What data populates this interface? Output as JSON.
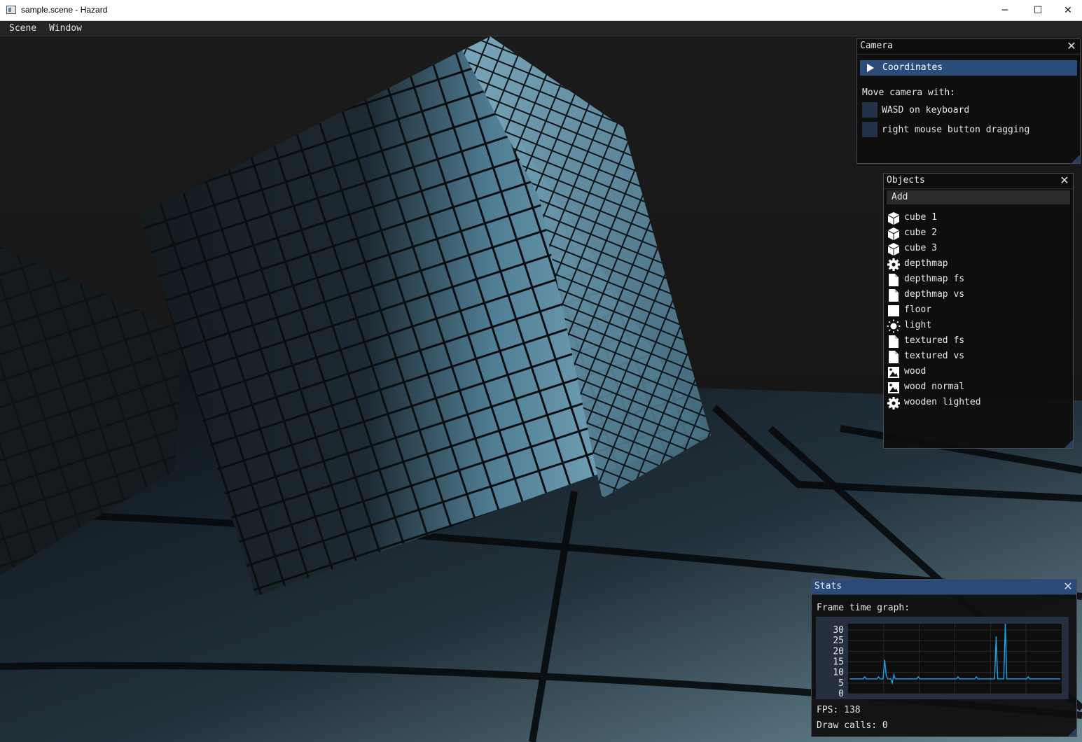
{
  "window": {
    "title": "sample.scene - Hazard",
    "controls": {
      "minimize": "─",
      "maximize": "☐",
      "close": "✕"
    }
  },
  "menubar": {
    "items": [
      "Scene",
      "Window"
    ]
  },
  "camera_panel": {
    "title": "Camera",
    "coordinates_label": "Coordinates",
    "hint": "Move camera with:",
    "options": [
      {
        "label": "WASD on keyboard",
        "checked": false
      },
      {
        "label": "right mouse button dragging",
        "checked": false
      }
    ]
  },
  "objects_panel": {
    "title": "Objects",
    "add_label": "Add",
    "items": [
      {
        "label": "cube 1",
        "icon": "cube-icon"
      },
      {
        "label": "cube 2",
        "icon": "cube-icon"
      },
      {
        "label": "cube 3",
        "icon": "cube-icon"
      },
      {
        "label": "depthmap",
        "icon": "gear-icon"
      },
      {
        "label": "depthmap fs",
        "icon": "file-icon"
      },
      {
        "label": "depthmap vs",
        "icon": "file-icon"
      },
      {
        "label": "floor",
        "icon": "square-icon"
      },
      {
        "label": "light",
        "icon": "sun-icon"
      },
      {
        "label": "textured fs",
        "icon": "file-icon"
      },
      {
        "label": "textured vs",
        "icon": "file-icon"
      },
      {
        "label": "wood",
        "icon": "image-icon"
      },
      {
        "label": "wood normal",
        "icon": "image-icon"
      },
      {
        "label": "wooden lighted",
        "icon": "gear-icon"
      }
    ]
  },
  "stats_panel": {
    "title": "Stats",
    "graph_label": "Frame time graph:",
    "fps_text": "FPS: 138",
    "draw_calls_text": "Draw calls: 0"
  },
  "chart_data": {
    "type": "line",
    "title": "Frame time graph:",
    "xlabel": "",
    "ylabel": "",
    "ylim": [
      0,
      33
    ],
    "yticks": [
      "30",
      "25",
      "20",
      "15",
      "10",
      "5",
      "0"
    ],
    "ytick_values": [
      30,
      25,
      20,
      15,
      10,
      5,
      0
    ],
    "grid": true,
    "line_color": "#1aa3e8",
    "values": [
      7,
      7,
      7,
      7,
      7,
      7,
      7,
      7,
      7,
      7,
      8,
      7,
      7,
      7,
      7,
      7,
      7,
      7,
      7,
      8,
      7,
      7,
      7,
      16,
      9,
      7,
      7,
      7,
      5,
      9,
      7,
      7,
      7,
      7,
      7,
      7,
      7,
      7,
      7,
      7,
      7,
      7,
      7,
      7,
      7,
      8,
      7,
      7,
      7,
      7,
      7,
      7,
      7,
      7,
      7,
      7,
      7,
      7,
      7,
      7,
      7,
      7,
      7,
      7,
      7,
      7,
      7,
      7,
      7,
      7,
      7,
      8,
      7,
      7,
      7,
      7,
      7,
      7,
      7,
      7,
      7,
      7,
      7,
      8,
      7,
      7,
      7,
      7,
      7,
      7,
      7,
      7,
      7,
      7,
      7,
      7,
      27,
      7,
      7,
      7,
      7,
      7,
      33,
      7,
      7,
      7,
      7,
      7,
      7,
      7,
      7,
      7,
      7,
      7,
      7,
      7,
      7,
      8,
      7,
      7,
      7,
      7,
      7,
      7,
      7,
      7,
      7,
      7,
      7,
      7,
      7,
      7,
      7,
      7,
      7,
      7,
      7,
      7,
      7
    ]
  },
  "colors": {
    "panel_active_header": "#294a7a",
    "collapsing_header": "#2b4b78",
    "checkbox": "#243248",
    "plot_line": "#1aa3e8"
  }
}
